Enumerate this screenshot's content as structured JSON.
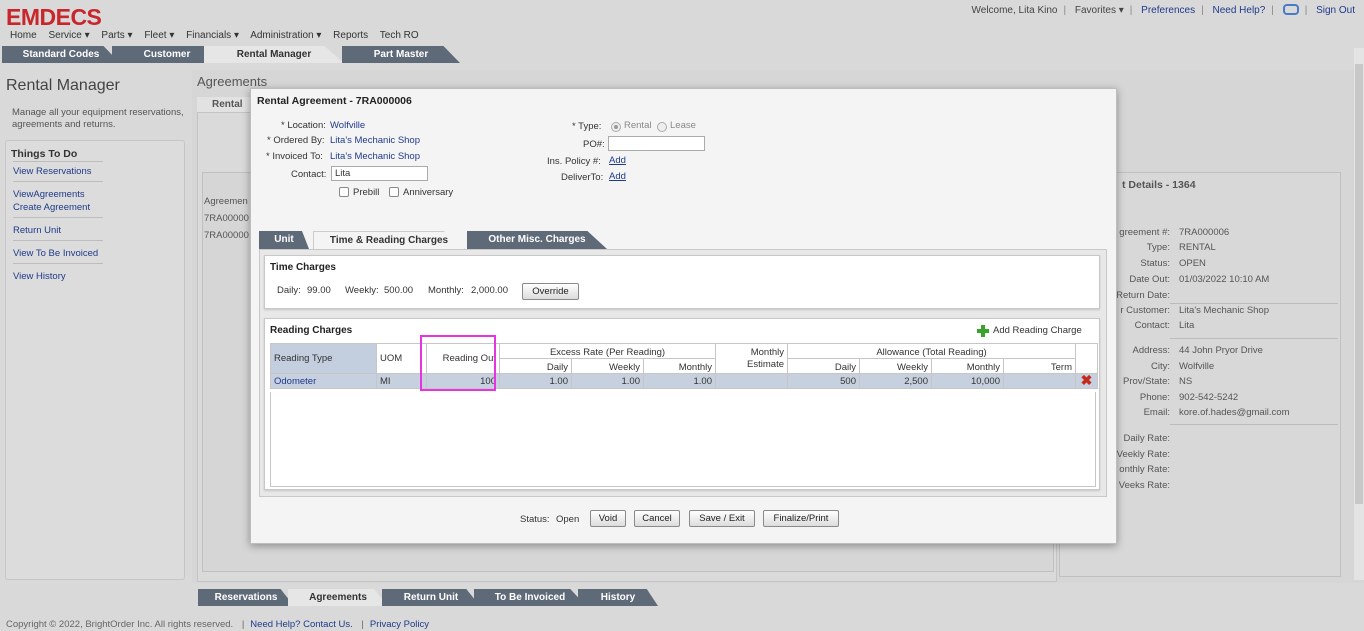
{
  "app": {
    "logo": "EMDECS"
  },
  "topbar": {
    "welcome": "Welcome, Lita Kino",
    "favorites": "Favorites ▾",
    "preferences": "Preferences",
    "help": "Need Help?",
    "signout": "Sign Out"
  },
  "nav": [
    "Home",
    "Service ▾",
    "Parts ▾",
    "Fleet ▾",
    "Financials ▾",
    "Administration ▾",
    "Reports",
    "Tech RO"
  ],
  "module_tabs": [
    "Standard Codes",
    "Customer",
    "Rental Manager",
    "Part Master"
  ],
  "left": {
    "title": "Rental Manager",
    "description": "Manage all your equipment reservations, agreements and returns.",
    "todo_title": "Things To Do",
    "todo": [
      "View Reservations",
      "ViewAgreements",
      "Create Agreement",
      "Return Unit",
      "View To Be Invoiced",
      "View History"
    ]
  },
  "bg": {
    "agreements_title": "Agreements",
    "sub_tab": "Rental",
    "list_header": "Agreemen",
    "list": [
      "7RA00000",
      "7RA00000"
    ]
  },
  "details": {
    "title": "t Details - 1364",
    "rows": [
      {
        "k": "greement #:",
        "v": "7RA000006"
      },
      {
        "k": "Type:",
        "v": "RENTAL"
      },
      {
        "k": "Status:",
        "v": "OPEN"
      },
      {
        "k": "Date Out:",
        "v": "01/03/2022 10:10 AM"
      },
      {
        "k": "Return Date:",
        "v": ""
      },
      {
        "k": "r Customer:",
        "v": "Lita's Mechanic Shop"
      },
      {
        "k": "Contact:",
        "v": "Lita"
      },
      {
        "k": "Address:",
        "v": "44 John Pryor Drive"
      },
      {
        "k": "City:",
        "v": "Wolfville"
      },
      {
        "k": "Prov/State:",
        "v": "NS"
      },
      {
        "k": "Phone:",
        "v": "902-542-5242"
      },
      {
        "k": "Email:",
        "v": "kore.of.hades@gmail.com"
      },
      {
        "k": "Daily Rate:",
        "v": ""
      },
      {
        "k": "Veekly Rate:",
        "v": ""
      },
      {
        "k": "onthly Rate:",
        "v": ""
      },
      {
        "k": "Veeks Rate:",
        "v": ""
      }
    ]
  },
  "bottom_tabs": [
    "Reservations",
    "Agreements",
    "Return Unit",
    "To Be Invoiced",
    "History"
  ],
  "footer": {
    "copyright": "Copyright © 2022, BrightOrder Inc. All rights reserved.",
    "help": "Need Help? Contact Us.",
    "privacy": "Privacy Policy"
  },
  "modal": {
    "title": "Rental Agreement - 7RA000006",
    "location_label": "* Location:",
    "location": "Wolfville",
    "ordered_label": "* Ordered By:",
    "ordered": "Lita's Mechanic Shop",
    "invoiced_label": "* Invoiced To:",
    "invoiced": "Lita's Mechanic Shop",
    "contact_label": "Contact:",
    "contact": "Lita",
    "prebill": "Prebill",
    "anniversary": "Anniversary",
    "type_label": "* Type:",
    "type_rental": "Rental",
    "type_lease": "Lease",
    "po_label": "PO#:",
    "po": "",
    "ins_label": "Ins. Policy #:",
    "ins_add": "Add",
    "deliver_label": "DeliverTo:",
    "deliver_add": "Add",
    "tabs": [
      "Unit",
      "Time & Reading Charges",
      "Other Misc. Charges"
    ],
    "time": {
      "title": "Time Charges",
      "daily_label": "Daily:",
      "daily": "99.00",
      "weekly_label": "Weekly:",
      "weekly": "500.00",
      "monthly_label": "Monthly:",
      "monthly": "2,000.00",
      "override": "Override"
    },
    "reading": {
      "title": "Reading Charges",
      "add": "Add Reading Charge",
      "headers": {
        "reading_type": "Reading Type",
        "uom": "UOM",
        "reading_out": "Reading Out",
        "excess": "Excess Rate (Per Reading)",
        "monthly_estimate_1": "Monthly",
        "monthly_estimate_2": "Estimate",
        "allowance": "Allowance (Total Reading)",
        "daily": "Daily",
        "weekly": "Weekly",
        "monthly": "Monthly",
        "term": "Term"
      },
      "row": {
        "type": "Odometer",
        "uom": "MI",
        "out": "100",
        "ex_daily": "1.00",
        "ex_weekly": "1.00",
        "ex_monthly": "1.00",
        "est": "",
        "al_daily": "500",
        "al_weekly": "2,500",
        "al_monthly": "10,000",
        "al_term": ""
      }
    },
    "footer": {
      "status_label": "Status:",
      "status": "Open",
      "void": "Void",
      "cancel": "Cancel",
      "save": "Save / Exit",
      "finalize": "Finalize/Print"
    }
  }
}
